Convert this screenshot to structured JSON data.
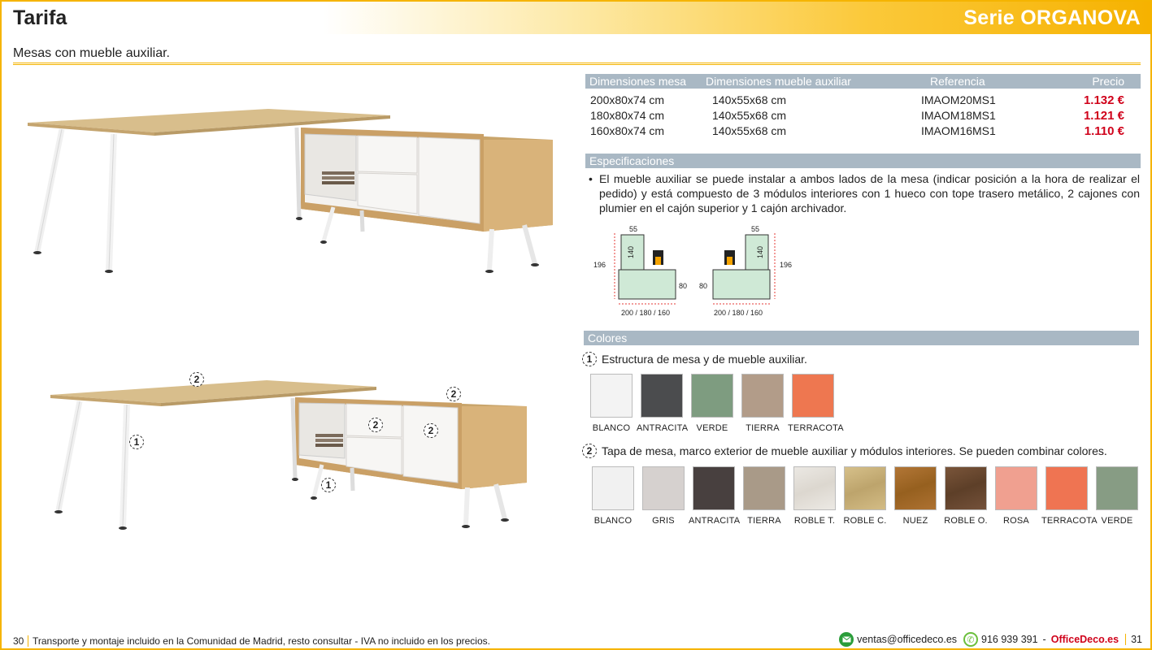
{
  "header": {
    "title": "Tarifa",
    "series": "Serie ORGANOVA"
  },
  "subtitle": "Mesas con mueble auxiliar.",
  "price_table": {
    "headers": [
      "Dimensiones mesa",
      "Dimensiones mueble auxiliar",
      "Referencia",
      "Precio"
    ],
    "rows": [
      {
        "mesa": "200x80x74 cm",
        "mueble": "140x55x68 cm",
        "ref": "IMAOM20MS1",
        "price": "1.132 €"
      },
      {
        "mesa": "180x80x74 cm",
        "mueble": "140x55x68 cm",
        "ref": "IMAOM18MS1",
        "price": "1.121 €"
      },
      {
        "mesa": "160x80x74 cm",
        "mueble": "140x55x68 cm",
        "ref": "IMAOM16MS1",
        "price": "1.110 €"
      }
    ]
  },
  "specs": {
    "title": "Especificaciones",
    "bullet": "•",
    "text": "El mueble auxiliar se puede instalar a ambos lados de la mesa (indicar posición a la hora de realizar el pedido) y está compuesto de 3 módulos interiores con 1 hueco con tope trasero metálico, 2 cajones con plumier en el cajón superior y 1 cajón archivador."
  },
  "diagrams": {
    "left": {
      "top": "55",
      "side": "140",
      "height": "196",
      "depth": "80",
      "width": "200 / 180 / 160"
    },
    "right": {
      "top": "55",
      "side": "140",
      "height": "196",
      "depth": "80",
      "width": "200 / 180 / 160"
    }
  },
  "colors": {
    "title": "Colores",
    "group1": {
      "num": "1",
      "label": "Estructura de mesa y de mueble auxiliar.",
      "swatches": [
        {
          "name": "BLANCO",
          "color": "#f3f3f3"
        },
        {
          "name": "ANTRACITA",
          "color": "#4b4c4e"
        },
        {
          "name": "VERDE",
          "color": "#7e9c80"
        },
        {
          "name": "TIERRA",
          "color": "#b29c89"
        },
        {
          "name": "TERRACOTA",
          "color": "#ee7750"
        }
      ]
    },
    "group2": {
      "num": "2",
      "label": "Tapa de mesa, marco exterior de mueble auxiliar y módulos interiores. Se pueden combinar colores.",
      "swatches": [
        {
          "name": "BLANCO",
          "color": "#f1f1f1"
        },
        {
          "name": "GRIS",
          "color": "#d6d1cf"
        },
        {
          "name": "ANTRACITA",
          "color": "#48403f"
        },
        {
          "name": "TIERRA",
          "color": "#a99a88"
        },
        {
          "name": "ROBLE T.",
          "color": "#e6e2dc"
        },
        {
          "name": "ROBLE C.",
          "color": "#c9b27c"
        },
        {
          "name": "NUEZ",
          "color": "#a86c2c"
        },
        {
          "name": "ROBLE O.",
          "color": "#6d4b30"
        },
        {
          "name": "ROSA",
          "color": "#f0a090"
        },
        {
          "name": "TERRACOTA",
          "color": "#ef7452"
        },
        {
          "name": "VERDE",
          "color": "#879c84"
        }
      ]
    }
  },
  "markers": {
    "one": "1",
    "two": "2"
  },
  "footer": {
    "page_left": "30",
    "note": "Transporte y montaje incluido en la Comunidad de Madrid, resto consultar - IVA no incluido en los precios.",
    "email": "ventas@officedeco.es",
    "phone": "916 939 391",
    "separator": "-",
    "brand": "OfficeDeco.es",
    "page_right": "31"
  }
}
